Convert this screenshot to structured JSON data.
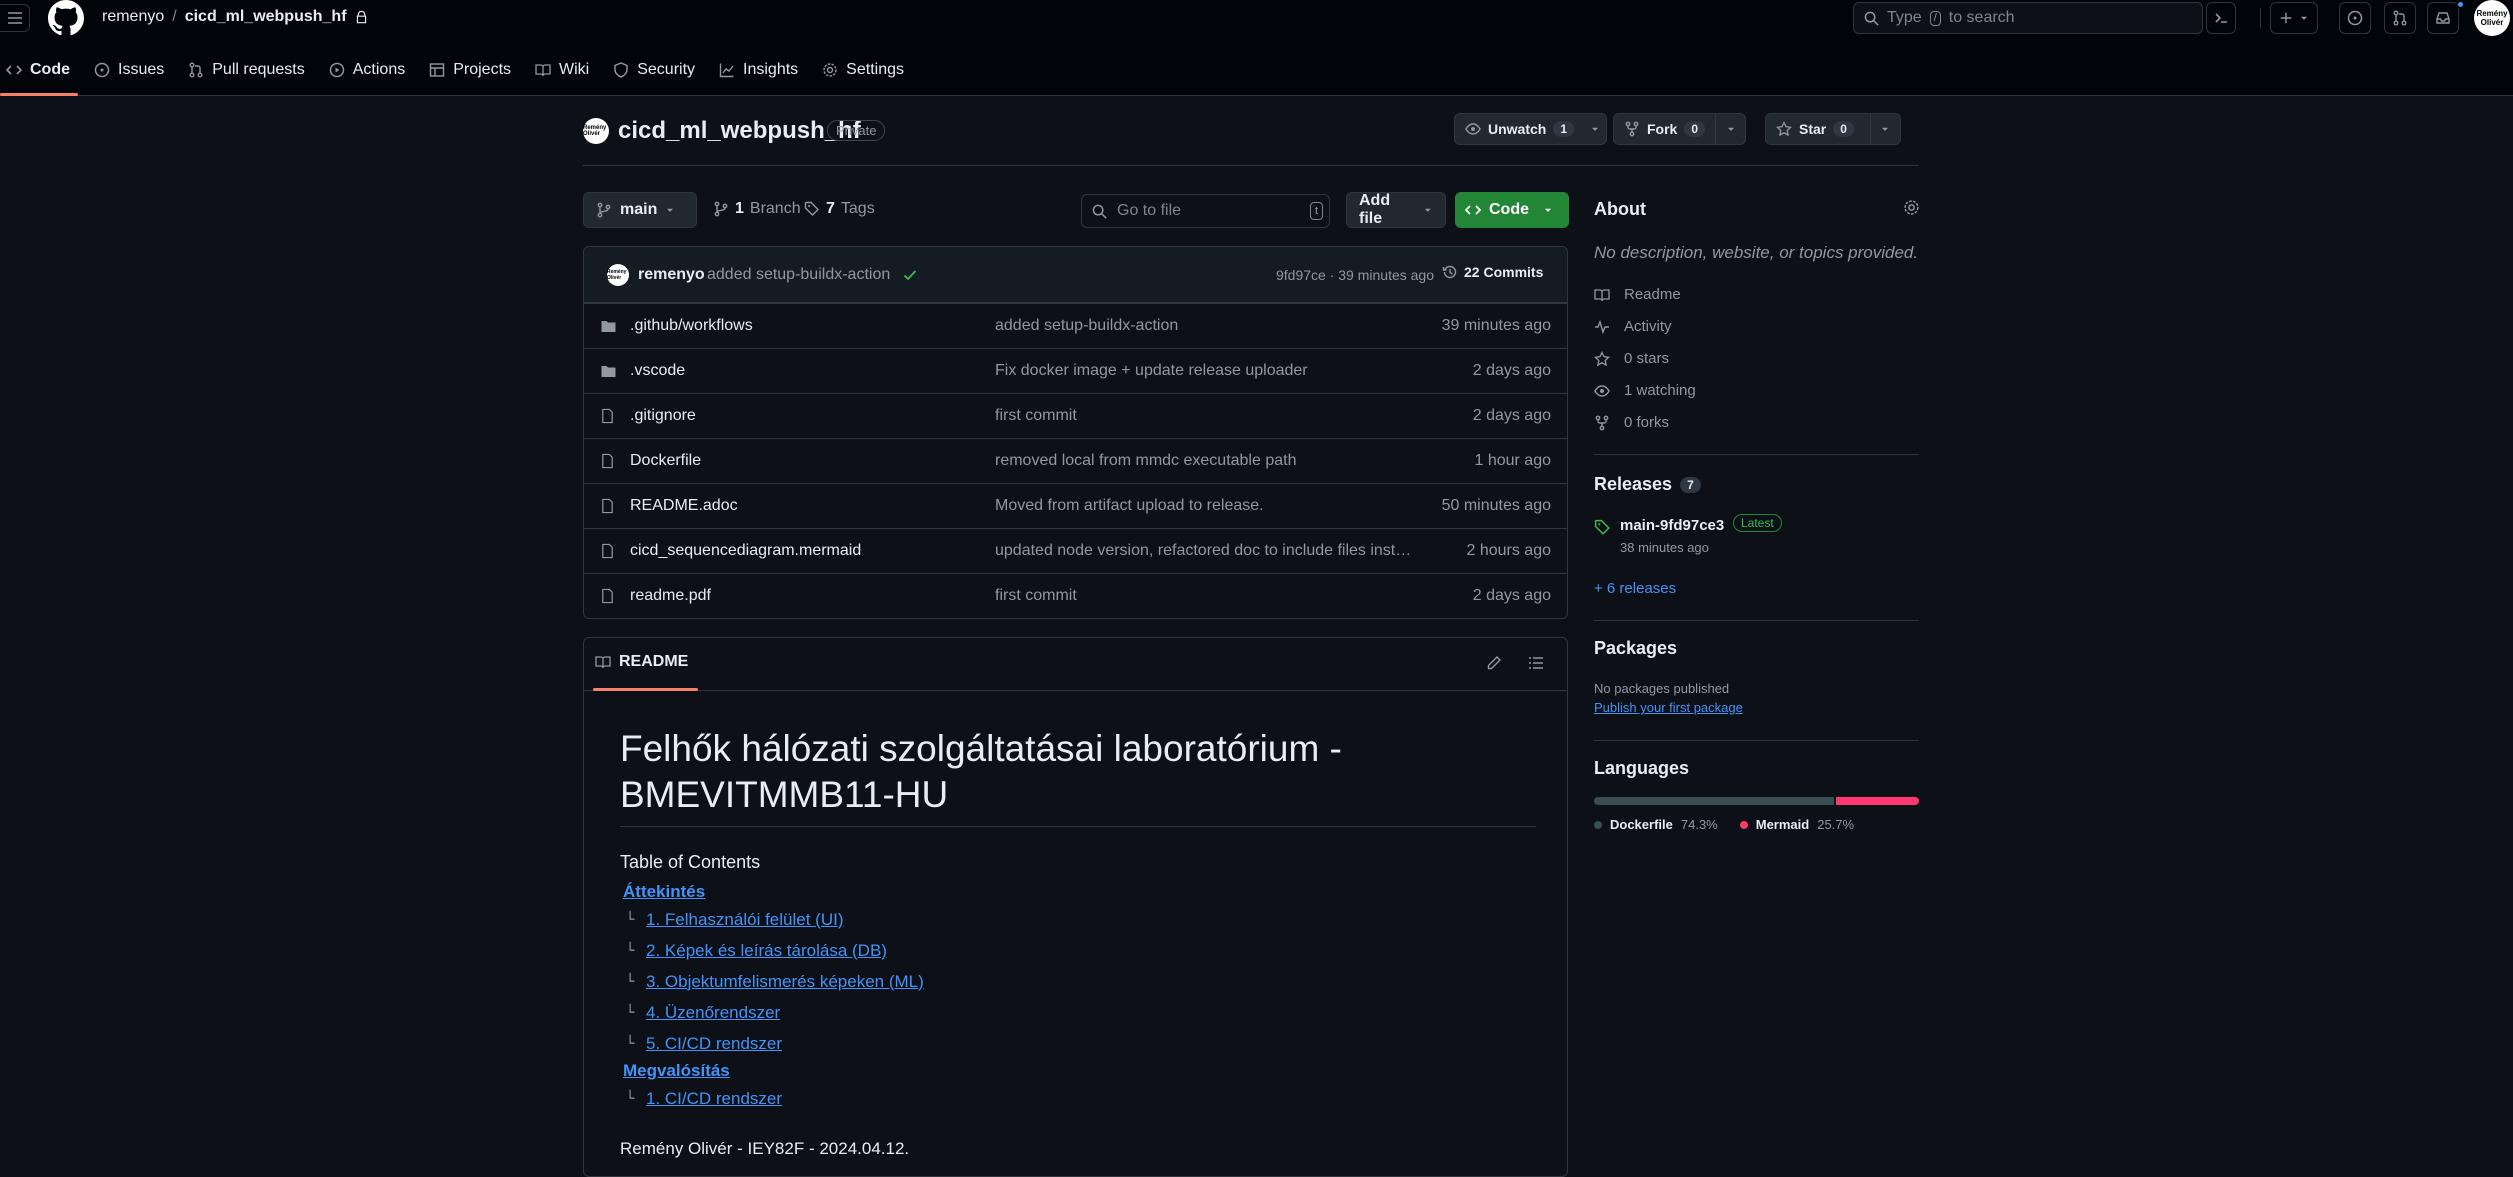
{
  "header": {
    "owner": "remenyo",
    "separator": "/",
    "repo": "cicd_ml_webpush_hf",
    "search_type": "Type",
    "search_key": "/",
    "search_suffix": "to search",
    "avatar_text": "Remény Olivér",
    "nav": [
      {
        "label": "Code",
        "icon": "code-icon"
      },
      {
        "label": "Issues",
        "icon": "issue-icon"
      },
      {
        "label": "Pull requests",
        "icon": "pull-request-icon"
      },
      {
        "label": "Actions",
        "icon": "play-icon"
      },
      {
        "label": "Projects",
        "icon": "table-icon"
      },
      {
        "label": "Wiki",
        "icon": "book-icon"
      },
      {
        "label": "Security",
        "icon": "shield-icon"
      },
      {
        "label": "Insights",
        "icon": "graph-icon"
      },
      {
        "label": "Settings",
        "icon": "gear-icon"
      }
    ]
  },
  "repo": {
    "avatar_text": "Remény Olivér",
    "name": "cicd_ml_webpush_hf",
    "visibility": "Private",
    "unwatch_label": "Unwatch",
    "watch_count": "1",
    "fork_label": "Fork",
    "fork_count": "0",
    "star_label": "Star",
    "star_count": "0"
  },
  "filenav": {
    "branch": "main",
    "branch_count": "1",
    "branch_word": "Branch",
    "tag_count": "7",
    "tag_word": "Tags",
    "goto_placeholder": "Go to file",
    "goto_key": "t",
    "add_file": "Add file",
    "code_button": "Code"
  },
  "commit": {
    "author": "remenyo",
    "message": "added setup-buildx-action",
    "hash_time": "9fd97ce · 39 minutes ago",
    "commits_label": "22 Commits"
  },
  "files": [
    {
      "type": "folder",
      "name": ".github/workflows",
      "message": "added setup-buildx-action",
      "date": "39 minutes ago"
    },
    {
      "type": "folder",
      "name": ".vscode",
      "message": "Fix docker image + update release uploader",
      "date": "2 days ago"
    },
    {
      "type": "file",
      "name": ".gitignore",
      "message": "first commit",
      "date": "2 days ago"
    },
    {
      "type": "file",
      "name": "Dockerfile",
      "message": "removed local from mmdc executable path",
      "date": "1 hour ago"
    },
    {
      "type": "file",
      "name": "README.adoc",
      "message": "Moved from artifact upload to release.",
      "date": "50 minutes ago"
    },
    {
      "type": "file",
      "name": "cicd_sequencediagram.mermaid",
      "message": "updated node version, refactored doc to include files instea...",
      "date": "2 hours ago"
    },
    {
      "type": "file",
      "name": "readme.pdf",
      "message": "first commit",
      "date": "2 days ago"
    }
  ],
  "readme": {
    "tab": "README",
    "title_line1": "Felhők hálózati szolgáltatásai laboratórium -",
    "title_line2": "BMEVITMMB11-HU",
    "toc_title": "Table of Contents",
    "toc": [
      {
        "label": "Áttekintés",
        "children": [
          "1. Felhasználói felület (UI)",
          "2. Képek és leírás tárolása (DB)",
          "3. Objektumfelismerés képeken (ML)",
          "4. Üzenőrendszer",
          "5. CI/CD rendszer"
        ]
      },
      {
        "label": "Megvalósítás",
        "children": [
          "1. CI/CD rendszer"
        ]
      }
    ],
    "branch_glyph": "└",
    "author_line": "Remény Olivér - IEY82F - 2024.04.12."
  },
  "about": {
    "title": "About",
    "description": "No description, website, or topics provided.",
    "items": [
      {
        "icon": "book-icon",
        "label": "Readme"
      },
      {
        "icon": "pulse-icon",
        "label": "Activity"
      },
      {
        "icon": "star-icon",
        "label": "0 stars"
      },
      {
        "icon": "eye-icon",
        "label": "1 watching"
      },
      {
        "icon": "fork-icon",
        "label": "0 forks"
      }
    ]
  },
  "releases": {
    "title": "Releases",
    "count": "7",
    "latest_name": "main-9fd97ce3",
    "latest_badge": "Latest",
    "latest_date": "38 minutes ago",
    "more": "+ 6 releases"
  },
  "packages": {
    "title": "Packages",
    "none": "No packages published",
    "link": "Publish your first package"
  },
  "languages": {
    "title": "Languages",
    "items": [
      {
        "name": "Dockerfile",
        "percent": "74.3%",
        "value": 74.3,
        "color": "#384d54"
      },
      {
        "name": "Mermaid",
        "percent": "25.7%",
        "value": 25.7,
        "color": "#ff3670"
      }
    ]
  }
}
